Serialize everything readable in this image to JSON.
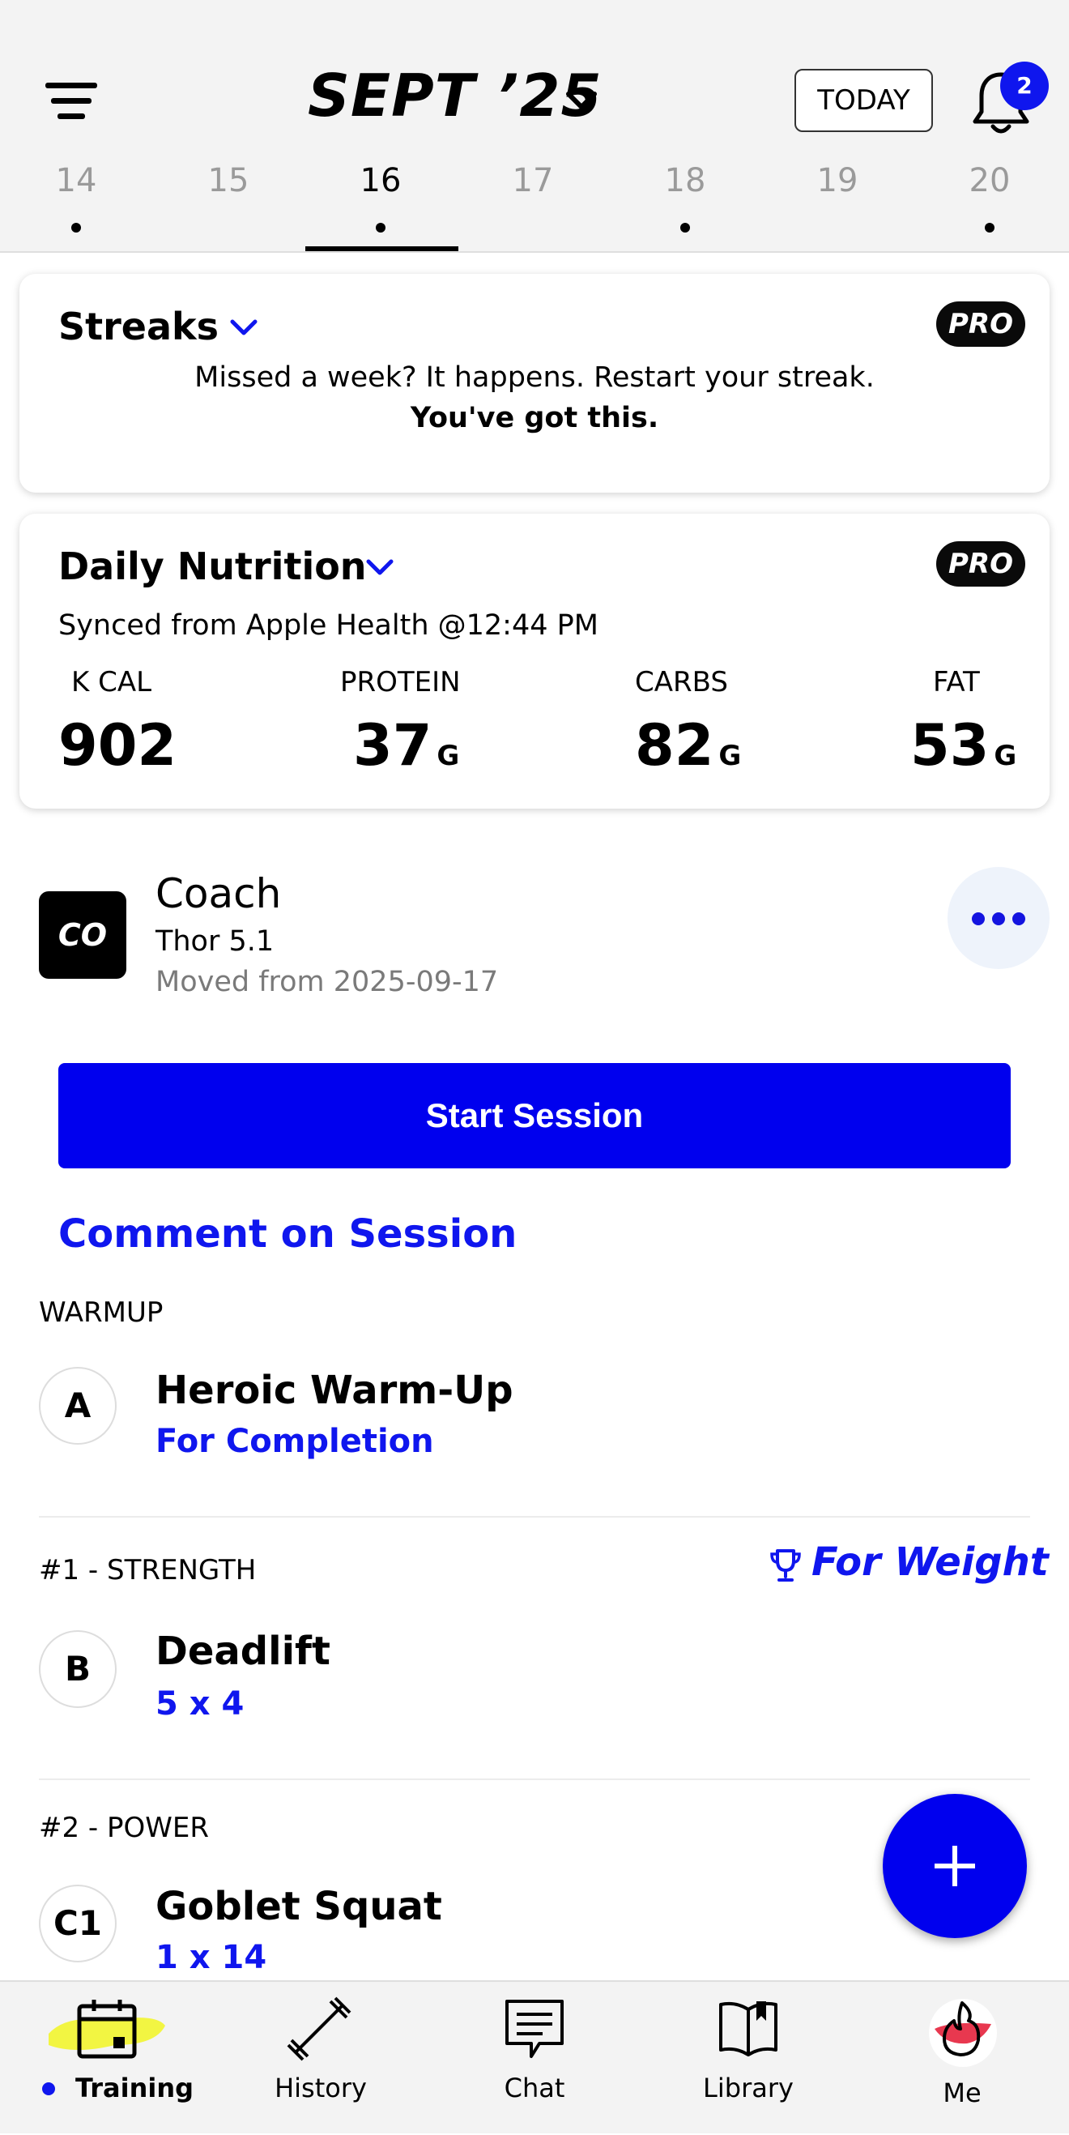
{
  "header": {
    "month": "SEPT ’25",
    "today_label": "TODAY",
    "notification_count": "2",
    "days": [
      "14",
      "15",
      "16",
      "17",
      "18",
      "19",
      "20"
    ],
    "selected_day": "16",
    "days_with_dots": [
      "14",
      "16",
      "18",
      "20"
    ]
  },
  "streaks": {
    "title": "Streaks",
    "badge": "PRO",
    "message": "Missed a week? It happens. Restart your streak.",
    "message_bold": "You've got this."
  },
  "nutrition": {
    "title": "Daily Nutrition",
    "badge": "PRO",
    "synced": "Synced from Apple Health @12:44 PM",
    "kcal_label": "K CAL",
    "kcal_value": "902",
    "protein_label": "PROTEIN",
    "protein_value": "37",
    "carbs_label": "CARBS",
    "carbs_value": "82",
    "fat_label": "FAT",
    "fat_value": "53",
    "unit": "G"
  },
  "coach": {
    "avatar_text": "CO",
    "name": "Coach",
    "program": "Thor 5.1",
    "moved": "Moved from 2025-09-17"
  },
  "session": {
    "start_label": "Start Session",
    "comment_label": "Comment on Session"
  },
  "sections": [
    {
      "header": "WARMUP",
      "letter": "A",
      "name": "Heroic Warm-Up",
      "detail": "For Completion"
    },
    {
      "header": "#1 - STRENGTH",
      "badge": "For Weight",
      "letter": "B",
      "name": "Deadlift",
      "detail": "5 x 4"
    },
    {
      "header": "#2 - POWER",
      "letter": "C1",
      "name": "Goblet Squat",
      "detail": "1 x 14"
    }
  ],
  "nav": {
    "items": [
      "Training",
      "History",
      "Chat",
      "Library",
      "Me"
    ],
    "active": "Training"
  },
  "colors": {
    "accent": "#0f16ee",
    "highlight": "#f2f542",
    "me_accent": "#e8384f"
  }
}
